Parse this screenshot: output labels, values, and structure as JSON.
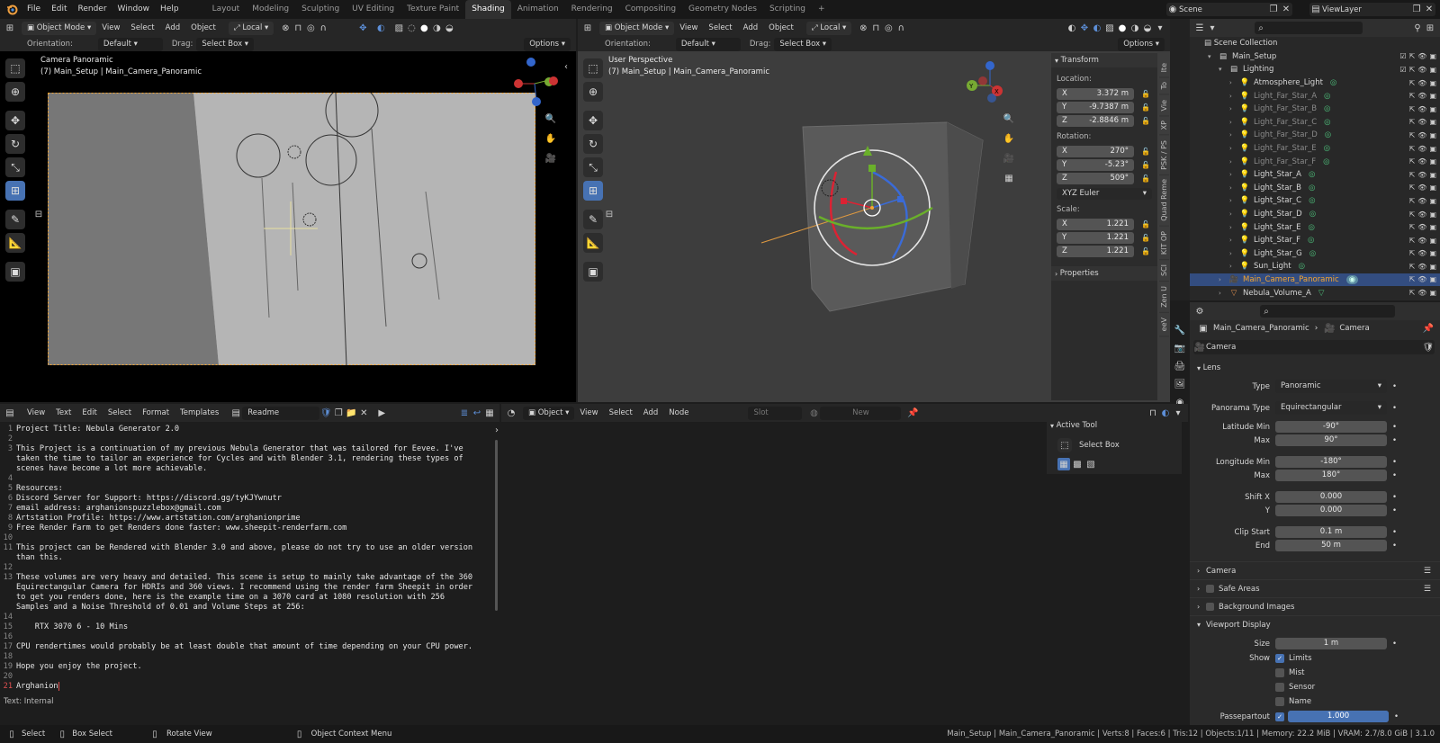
{
  "topbar": {
    "menus": [
      "File",
      "Edit",
      "Render",
      "Window",
      "Help"
    ],
    "workspaces": [
      "Layout",
      "Modeling",
      "Sculpting",
      "UV Editing",
      "Texture Paint",
      "Shading",
      "Animation",
      "Rendering",
      "Compositing",
      "Geometry Nodes",
      "Scripting"
    ],
    "active_workspace": "Shading",
    "add_tab": "+",
    "scene_label": "Scene",
    "view_layer_label": "ViewLayer"
  },
  "viewport_left": {
    "mode": "Object Mode",
    "menus": [
      "View",
      "Select",
      "Add",
      "Object"
    ],
    "transform_orientation": "Local",
    "orientation_label": "Orientation:",
    "orientation_value": "Default",
    "drag_label": "Drag:",
    "drag_value": "Select Box",
    "options_label": "Options",
    "overlay_title": "Camera Panoramic",
    "overlay_subtitle": "(7) Main_Setup | Main_Camera_Panoramic"
  },
  "viewport_right": {
    "mode": "Object Mode",
    "menus": [
      "View",
      "Select",
      "Add",
      "Object"
    ],
    "transform_orientation": "Local",
    "orientation_label": "Orientation:",
    "orientation_value": "Default",
    "drag_label": "Drag:",
    "drag_value": "Select Box",
    "options_label": "Options",
    "overlay_title": "User Perspective",
    "overlay_subtitle": "(7) Main_Setup | Main_Camera_Panoramic",
    "gizmo_x": "X",
    "gizmo_y": "Y",
    "gizmo_z": "Z"
  },
  "n_panel": {
    "transform_title": "Transform",
    "location_label": "Location:",
    "location": [
      {
        "axis": "X",
        "value": "3.372 m"
      },
      {
        "axis": "Y",
        "value": "-9.7387 m"
      },
      {
        "axis": "Z",
        "value": "-2.8846 m"
      }
    ],
    "rotation_label": "Rotation:",
    "rotation": [
      {
        "axis": "X",
        "value": "270°"
      },
      {
        "axis": "Y",
        "value": "-5.23°"
      },
      {
        "axis": "Z",
        "value": "509°"
      }
    ],
    "rotation_mode": "XYZ Euler",
    "scale_label": "Scale:",
    "scale": [
      {
        "axis": "X",
        "value": "1.221"
      },
      {
        "axis": "Y",
        "value": "1.221"
      },
      {
        "axis": "Z",
        "value": "1.221"
      }
    ],
    "properties_title": "Properties",
    "side_tabs": [
      "Ite",
      "To",
      "Vie",
      "XP",
      "PSK / PS",
      "Quad Reme",
      "KIT OP",
      "SCI",
      "Zen U",
      "eeV"
    ]
  },
  "outliner": {
    "search_placeholder": "",
    "root": "Scene Collection",
    "items": [
      {
        "name": "Main_Setup",
        "depth": 1,
        "type": "collection",
        "dim": false,
        "selected": false
      },
      {
        "name": "Lighting",
        "depth": 2,
        "type": "collection",
        "dim": false,
        "selected": false
      },
      {
        "name": "Atmosphere_Light",
        "depth": 3,
        "type": "light",
        "dim": false,
        "selected": false
      },
      {
        "name": "Light_Far_Star_A",
        "depth": 3,
        "type": "light",
        "dim": true,
        "selected": false
      },
      {
        "name": "Light_Far_Star_B",
        "depth": 3,
        "type": "light",
        "dim": true,
        "selected": false
      },
      {
        "name": "Light_Far_Star_C",
        "depth": 3,
        "type": "light",
        "dim": true,
        "selected": false
      },
      {
        "name": "Light_Far_Star_D",
        "depth": 3,
        "type": "light",
        "dim": true,
        "selected": false
      },
      {
        "name": "Light_Far_Star_E",
        "depth": 3,
        "type": "light",
        "dim": true,
        "selected": false
      },
      {
        "name": "Light_Far_Star_F",
        "depth": 3,
        "type": "light",
        "dim": true,
        "selected": false
      },
      {
        "name": "Light_Star_A",
        "depth": 3,
        "type": "light",
        "dim": false,
        "selected": false
      },
      {
        "name": "Light_Star_B",
        "depth": 3,
        "type": "light",
        "dim": false,
        "selected": false
      },
      {
        "name": "Light_Star_C",
        "depth": 3,
        "type": "light",
        "dim": false,
        "selected": false
      },
      {
        "name": "Light_Star_D",
        "depth": 3,
        "type": "light",
        "dim": false,
        "selected": false
      },
      {
        "name": "Light_Star_E",
        "depth": 3,
        "type": "light",
        "dim": false,
        "selected": false
      },
      {
        "name": "Light_Star_F",
        "depth": 3,
        "type": "light",
        "dim": false,
        "selected": false
      },
      {
        "name": "Light_Star_G",
        "depth": 3,
        "type": "light",
        "dim": false,
        "selected": false
      },
      {
        "name": "Sun_Light",
        "depth": 3,
        "type": "light",
        "dim": false,
        "selected": false
      },
      {
        "name": "Main_Camera_Panoramic",
        "depth": 2,
        "type": "camera",
        "dim": false,
        "selected": true
      },
      {
        "name": "Nebula_Volume_A",
        "depth": 2,
        "type": "mesh",
        "dim": false,
        "selected": false
      }
    ]
  },
  "properties": {
    "object_name": "Main_Camera_Panoramic",
    "data_type": "Camera",
    "data_name": "Camera",
    "lens_title": "Lens",
    "type_label": "Type",
    "type_value": "Panoramic",
    "panorama_type_label": "Panorama Type",
    "panorama_type_value": "Equirectangular",
    "fields": [
      {
        "label": "Latitude Min",
        "value": "-90°"
      },
      {
        "label": "Max",
        "value": "90°"
      },
      {
        "label": "Longitude Min",
        "value": "-180°"
      },
      {
        "label": "Max",
        "value": "180°"
      },
      {
        "label": "Shift X",
        "value": "0.000"
      },
      {
        "label": "Y",
        "value": "0.000"
      },
      {
        "label": "Clip Start",
        "value": "0.1 m"
      },
      {
        "label": "End",
        "value": "50 m"
      }
    ],
    "sections": [
      "Camera",
      "Safe Areas",
      "Background Images",
      "Viewport Display"
    ],
    "size_label": "Size",
    "size_value": "1 m",
    "show_label": "Show",
    "checks": [
      {
        "label": "Limits",
        "checked": true
      },
      {
        "label": "Mist",
        "checked": false
      },
      {
        "label": "Sensor",
        "checked": false
      },
      {
        "label": "Name",
        "checked": false
      }
    ],
    "passepartout_label": "Passepartout",
    "passepartout_value": "1.000",
    "passepartout_fraction": 1.0
  },
  "text_editor": {
    "menus": [
      "View",
      "Text",
      "Edit",
      "Select",
      "Format",
      "Templates"
    ],
    "file_name": "Readme",
    "status": "Text: Internal",
    "lines": [
      {
        "n": "1",
        "t": "Project Title: Nebula Generator 2.0"
      },
      {
        "n": "2",
        "t": ""
      },
      {
        "n": "3",
        "t": "This Project is a continuation of my previous Nebula Generator that was tailored for Eevee. I've"
      },
      {
        "n": "",
        "t": "taken the time to tailor an experience for Cycles and with Blender 3.1, rendering these types of"
      },
      {
        "n": "",
        "t": "scenes have become a lot more achievable."
      },
      {
        "n": "4",
        "t": ""
      },
      {
        "n": "5",
        "t": "Resources:"
      },
      {
        "n": "6",
        "t": "Discord Server for Support: https://discord.gg/tyKJYwnutr"
      },
      {
        "n": "7",
        "t": "email address: arghanionspuzzlebox@gmail.com"
      },
      {
        "n": "8",
        "t": "Artstation Profile: https://www.artstation.com/arghanionprime"
      },
      {
        "n": "9",
        "t": "Free Render Farm to get Renders done faster: www.sheepit-renderfarm.com"
      },
      {
        "n": "10",
        "t": ""
      },
      {
        "n": "11",
        "t": "This project can be Rendered with Blender 3.0 and above, please do not try to use an older version"
      },
      {
        "n": "",
        "t": "than this."
      },
      {
        "n": "12",
        "t": ""
      },
      {
        "n": "13",
        "t": "These volumes are very heavy and detailed. This scene is setup to mainly take advantage of the 360"
      },
      {
        "n": "",
        "t": "Equirectangular Camera for HDRIs and 360 views. I recommend using the render farm Sheepit in order"
      },
      {
        "n": "",
        "t": "to get you renders done, here is the example time on a 3070 card at 1080 resolution with 256"
      },
      {
        "n": "",
        "t": "Samples and a Noise Threshold of 0.01 and Volume Steps at 256:"
      },
      {
        "n": "14",
        "t": ""
      },
      {
        "n": "15",
        "t": "    RTX 3070 6 - 10 Mins"
      },
      {
        "n": "16",
        "t": ""
      },
      {
        "n": "17",
        "t": "CPU rendertimes would probably be at least double that amount of time depending on your CPU power."
      },
      {
        "n": "18",
        "t": ""
      },
      {
        "n": "19",
        "t": "Hope you enjoy the project."
      },
      {
        "n": "20",
        "t": ""
      },
      {
        "n": "21",
        "t": "Arghanion"
      }
    ]
  },
  "node_editor": {
    "mode": "Object",
    "menus": [
      "View",
      "Select",
      "Add",
      "Node"
    ],
    "slot_label": "Slot",
    "new_label": "New",
    "active_tool_title": "Active Tool",
    "active_tool_name": "Select Box"
  },
  "statusbar": {
    "select_label": "Select",
    "box_select_label": "Box Select",
    "rotate_label": "Rotate View",
    "context_menu_label": "Object Context Menu",
    "stats": "Main_Setup | Main_Camera_Panoramic | Verts:8 | Faces:6 | Tris:12 | Objects:1/11 | Memory: 22.2 MiB | VRAM: 2.7/8.0 GiB | 3.1.0"
  },
  "colors": {
    "accent": "#4772b3",
    "selection_orange": "#f5a531",
    "light_icon": "#e09050",
    "light_data_icon": "#4cbb78",
    "camera_data_icon": "#5aa0c0"
  }
}
